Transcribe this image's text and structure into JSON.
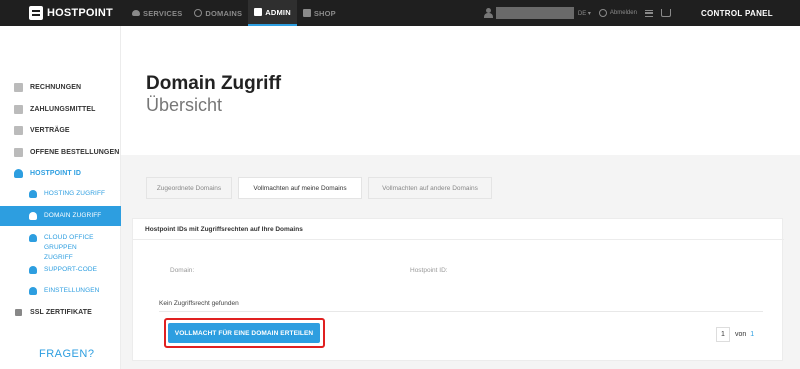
{
  "topbar": {
    "brand": "HOSTPOINT",
    "nav": [
      {
        "label": "SERVICES",
        "icon": "cloud-icon"
      },
      {
        "label": "DOMAINS",
        "icon": "globe-icon"
      },
      {
        "label": "ADMIN",
        "icon": "admin-icon",
        "active": true
      },
      {
        "label": "SHOP",
        "icon": "shop-icon"
      }
    ],
    "language": "DE ▾",
    "logout": "Abmelden",
    "control_panel": "CONTROL PANEL"
  },
  "sidebar": {
    "items": [
      {
        "label": "RECHNUNGEN",
        "icon": "invoice-icon"
      },
      {
        "label": "ZAHLUNGSMITTEL",
        "icon": "payment-icon"
      },
      {
        "label": "VERTRÄGE",
        "icon": "contract-icon"
      },
      {
        "label": "OFFENE BESTELLUNGEN",
        "icon": "order-icon"
      },
      {
        "label": "HOSTPOINT ID",
        "icon": "user-icon"
      }
    ],
    "sub": [
      {
        "label": "HOSTING ZUGRIFF",
        "icon": "user-icon"
      },
      {
        "label": "DOMAIN ZUGRIFF",
        "icon": "user-icon",
        "active": true
      },
      {
        "label_1": "CLOUD OFFICE GRUPPEN",
        "label_2": "ZUGRIFF",
        "icon": "group-icon"
      },
      {
        "label": "SUPPORT-CODE",
        "icon": "chat-icon"
      },
      {
        "label": "EINSTELLUNGEN",
        "icon": "gear-icon"
      }
    ],
    "ssl": "SSL ZERTIFIKATE",
    "help": "FRAGEN?"
  },
  "page": {
    "title": "Domain Zugriff",
    "subtitle": "Übersicht"
  },
  "tabs": [
    {
      "label": "Zugeordnete Domains"
    },
    {
      "label": "Vollmachten auf meine Domains",
      "active": true
    },
    {
      "label": "Vollmachten auf andere Domains"
    }
  ],
  "panel": {
    "heading": "Hostpoint IDs mit Zugriffsrechten auf Ihre Domains",
    "columns": [
      "Domain:",
      "Hostpoint ID:"
    ],
    "empty_text": "Kein Zugriffsrecht gefunden",
    "cta": "VOLLMACHT FÜR EINE DOMAIN ERTEILEN"
  },
  "pagination": {
    "current": "1",
    "of": "von",
    "total": "1"
  },
  "colors": {
    "accent": "#2d9ee0",
    "topbar": "#1f1f1f",
    "highlight": "#e02020"
  }
}
